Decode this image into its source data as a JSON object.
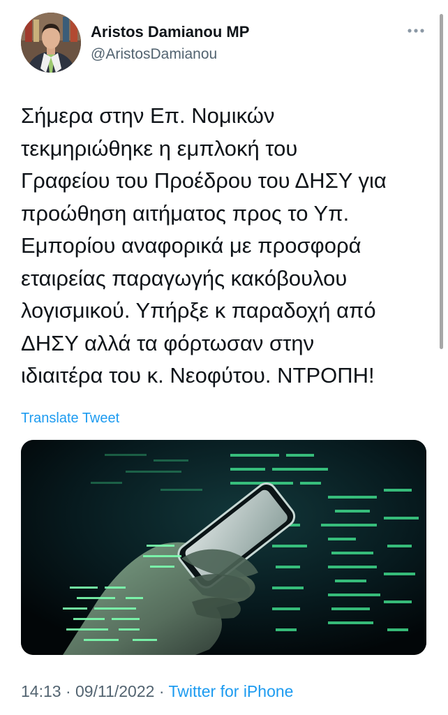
{
  "author": {
    "name": "Aristos Damianou MP",
    "handle": "@AristosDamianou"
  },
  "icons": {
    "more": "more-horizontal-icon"
  },
  "tweet": {
    "lines": [
      "Σήμερα στην Επ. Νομικών",
      "τεκμηριώθηκε η εμπλοκή του",
      "Γραφείου του Προέδρου του ΔΗΣΥ για",
      "προώθηση αιτήματος προς το Υπ.",
      "Εμπορίου αναφορικά με προσφορά",
      "εταιρείας παραγωγής κακόβουλου",
      "λογισμικού. Υπήρξε κ παραδοχή από",
      "ΔΗΣΥ αλλά τα φόρτωσαν στην",
      "ιδιαιτέρα του κ. Νεοφύτου. ΝΤΡΟΠΗ!"
    ],
    "translate_label": "Translate Tweet"
  },
  "meta": {
    "time": "14:13",
    "separator": "·",
    "date": "09/11/2022",
    "source": "Twitter for iPhone"
  },
  "colors": {
    "link": "#1d9bf0",
    "secondary_text": "#536471",
    "code_glow": "#39d67a"
  }
}
